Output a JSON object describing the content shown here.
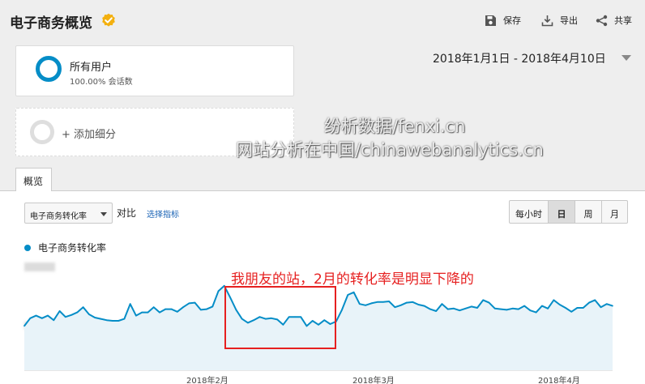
{
  "header": {
    "title": "电子商务概览",
    "actions": [
      {
        "label": "保存",
        "icon": "save-icon"
      },
      {
        "label": "导出",
        "icon": "export-icon"
      },
      {
        "label": "共享",
        "icon": "share-icon"
      }
    ]
  },
  "segments": {
    "primary": {
      "name": "所有用户",
      "subtitle": "100.00% 会话数"
    },
    "add_label": "+ 添加细分"
  },
  "date_range": "2018年1月1日 - 2018年4月10日",
  "watermark": {
    "line1": "纷析数据/fenxi.cn",
    "line2": "网站分析在中国/chinawebanalytics.cn"
  },
  "tab": {
    "label": "概览"
  },
  "controls": {
    "metric": "电子商务转化率",
    "compare_label": "对比",
    "choose_metric": "选择指标",
    "granularity": [
      "每小时",
      "日",
      "周",
      "月"
    ],
    "selected_granularity": "日"
  },
  "annotation": "我朋友的站，2月的转化率是明显下降的",
  "colors": {
    "series": "#058dc7",
    "area": "#e8f3f9",
    "annotation": "#e62020",
    "link": "#1a63b5"
  },
  "chart_data": {
    "type": "area",
    "legend": [
      "电子商务转化率"
    ],
    "x_ticks": [
      "2018年2月",
      "2018年3月",
      "2018年4月"
    ],
    "y_scale": "relative 0-1 (no visible axis values)",
    "series": [
      {
        "name": "电子商务转化率",
        "values": [
          0.22,
          0.34,
          0.38,
          0.34,
          0.38,
          0.31,
          0.45,
          0.36,
          0.39,
          0.43,
          0.51,
          0.4,
          0.35,
          0.33,
          0.31,
          0.3,
          0.3,
          0.33,
          0.56,
          0.38,
          0.43,
          0.43,
          0.51,
          0.43,
          0.48,
          0.48,
          0.44,
          0.51,
          0.57,
          0.58,
          0.47,
          0.48,
          0.52,
          0.76,
          0.84,
          0.66,
          0.47,
          0.33,
          0.27,
          0.31,
          0.36,
          0.33,
          0.34,
          0.32,
          0.24,
          0.36,
          0.36,
          0.36,
          0.22,
          0.3,
          0.24,
          0.31,
          0.25,
          0.29,
          0.47,
          0.7,
          0.74,
          0.56,
          0.54,
          0.57,
          0.59,
          0.59,
          0.6,
          0.51,
          0.54,
          0.58,
          0.59,
          0.55,
          0.53,
          0.48,
          0.45,
          0.56,
          0.48,
          0.49,
          0.46,
          0.49,
          0.52,
          0.5,
          0.62,
          0.58,
          0.49,
          0.48,
          0.47,
          0.49,
          0.48,
          0.53,
          0.46,
          0.43,
          0.53,
          0.49,
          0.62,
          0.55,
          0.5,
          0.44,
          0.5,
          0.5,
          0.58,
          0.62,
          0.51,
          0.56,
          0.53
        ]
      }
    ]
  }
}
